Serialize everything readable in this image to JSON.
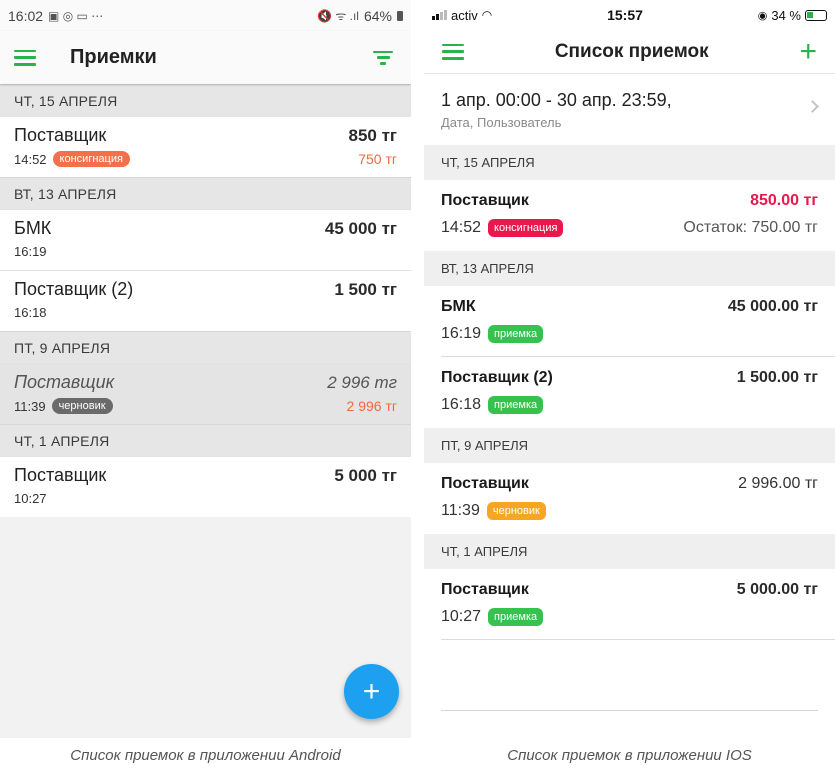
{
  "android": {
    "status": {
      "time": "16:02",
      "left_icons": "▣ ◎ ▭ ⋯",
      "right_icons": "🔇 ᯤ .ıl",
      "battery": "64%"
    },
    "title": "Приемки",
    "fab_label": "+",
    "sections": [
      {
        "header": "ЧТ, 15 АПРЕЛЯ",
        "rows": [
          {
            "name": "Поставщик",
            "amount": "850 тг",
            "time": "14:52",
            "badge": "консигнация",
            "badge_type": "cons",
            "sub": "750 тг"
          }
        ]
      },
      {
        "header": "ВТ, 13 АПРЕЛЯ",
        "rows": [
          {
            "name": "БМК",
            "amount": "45 000 тг",
            "time": "16:19",
            "badge": "",
            "badge_type": "",
            "sub": ""
          },
          {
            "name": "Поставщик (2)",
            "amount": "1 500 тг",
            "time": "16:18",
            "badge": "",
            "badge_type": "",
            "sub": ""
          }
        ]
      },
      {
        "header": "ПТ, 9 АПРЕЛЯ",
        "rows": [
          {
            "name": "Поставщик",
            "amount": "2 996 тг",
            "time": "11:39",
            "badge": "черновик",
            "badge_type": "draft",
            "sub": "2 996 тг"
          }
        ]
      },
      {
        "header": "ЧТ, 1 АПРЕЛЯ",
        "rows": [
          {
            "name": "Поставщик",
            "amount": "5 000 тг",
            "time": "10:27",
            "badge": "",
            "badge_type": "",
            "sub": ""
          }
        ]
      }
    ]
  },
  "ios": {
    "status": {
      "carrier": "activ",
      "time": "15:57",
      "battery": "34 %"
    },
    "title": "Список приемок",
    "add_label": "+",
    "filter": {
      "period": "1 апр. 00:00 - 30 апр. 23:59,",
      "hint": "Дата, Пользователь"
    },
    "sections": [
      {
        "header": "ЧТ, 15 АПРЕЛЯ",
        "rows": [
          {
            "name": "Поставщик",
            "amount": "850.00 тг",
            "amount_style": "red",
            "time": "14:52",
            "badge": "консигнация",
            "badge_type": "cons",
            "sub": "Остаток: 750.00 тг"
          }
        ]
      },
      {
        "header": "ВТ, 13 АПРЕЛЯ",
        "rows": [
          {
            "name": "БМК",
            "amount": "45 000.00 тг",
            "amount_style": "",
            "time": "16:19",
            "badge": "приемка",
            "badge_type": "rec",
            "sub": ""
          },
          {
            "name": "Поставщик (2)",
            "amount": "1 500.00 тг",
            "amount_style": "",
            "time": "16:18",
            "badge": "приемка",
            "badge_type": "rec",
            "sub": ""
          }
        ]
      },
      {
        "header": "ПТ, 9 АПРЕЛЯ",
        "rows": [
          {
            "name": "Поставщик",
            "amount": "2 996.00 тг",
            "amount_style": "light",
            "time": "11:39",
            "badge": "черновик",
            "badge_type": "draft",
            "sub": ""
          }
        ]
      },
      {
        "header": "ЧТ, 1 АПРЕЛЯ",
        "rows": [
          {
            "name": "Поставщик",
            "amount": "5 000.00 тг",
            "amount_style": "",
            "time": "10:27",
            "badge": "приемка",
            "badge_type": "rec",
            "sub": ""
          }
        ]
      }
    ]
  },
  "captions": {
    "android": "Список приемок в приложении Android",
    "ios": "Список приемок в приложении IOS"
  },
  "colors": {
    "accent_green": "#2bb24c",
    "fab_blue": "#1ea0f0",
    "ios_red": "#e8184c",
    "android_orange": "#f3704a",
    "draft_yellow": "#f6a623"
  }
}
